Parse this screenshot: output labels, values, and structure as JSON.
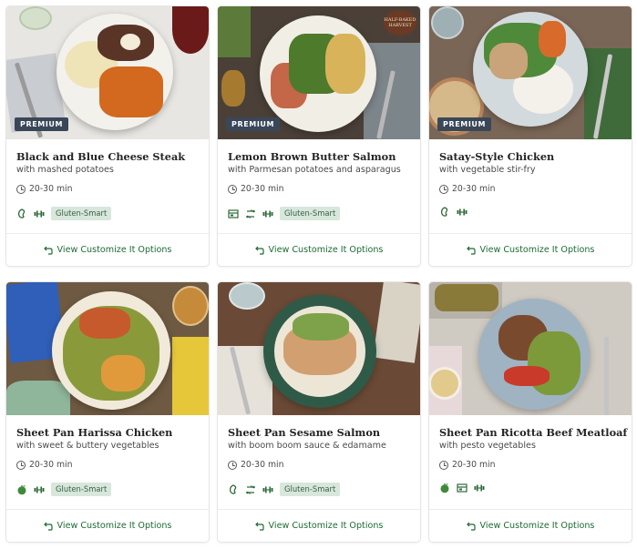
{
  "cards": [
    {
      "badge": "PREMIUM",
      "title": "Black and Blue Cheese Steak",
      "subtitle": "with mashed potatoes",
      "time": "20-30 min",
      "icons": [
        "carb-smart-icon",
        "protein-icon"
      ],
      "pill": "Gluten-Smart",
      "cta": "View Customize It Options"
    },
    {
      "badge": "PREMIUM",
      "title": "Lemon Brown Butter Salmon",
      "subtitle": "with Parmesan potatoes and asparagus",
      "time": "20-30 min",
      "icons": [
        "quick-meal-icon",
        "customize-icon",
        "protein-icon"
      ],
      "pill": "Gluten-Smart",
      "cta": "View Customize It Options",
      "stamp_top": "HALF-BAKED",
      "stamp_bottom": "HARVEST"
    },
    {
      "badge": "PREMIUM",
      "title": "Satay-Style Chicken",
      "subtitle": "with vegetable stir-fry",
      "time": "20-30 min",
      "icons": [
        "carb-smart-icon",
        "protein-icon"
      ],
      "pill": "",
      "cta": "View Customize It Options"
    },
    {
      "badge": "",
      "title": "Sheet Pan Harissa Chicken",
      "subtitle": "with sweet & buttery vegetables",
      "time": "20-30 min",
      "icons": [
        "calorie-smart-icon",
        "protein-icon"
      ],
      "pill": "Gluten-Smart",
      "cta": "View Customize It Options"
    },
    {
      "badge": "",
      "title": "Sheet Pan Sesame Salmon",
      "subtitle": "with boom boom sauce & edamame",
      "time": "20-30 min",
      "icons": [
        "carb-smart-icon",
        "customize-icon",
        "protein-icon"
      ],
      "pill": "Gluten-Smart",
      "cta": "View Customize It Options"
    },
    {
      "badge": "",
      "title": "Sheet Pan Ricotta Beef Meatloaf",
      "subtitle": "with pesto vegetables",
      "time": "20-30 min",
      "icons": [
        "calorie-smart-icon",
        "quick-meal-icon",
        "protein-icon"
      ],
      "pill": "",
      "cta": "View Customize It Options"
    }
  ],
  "colors": {
    "accent_green": "#1d6b33",
    "badge_bg": "#3a4759",
    "pill_bg": "#d7e7dc"
  }
}
